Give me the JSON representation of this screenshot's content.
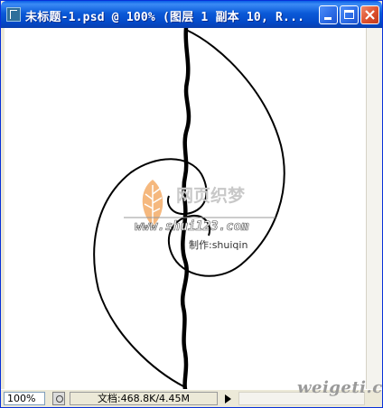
{
  "window": {
    "title": "未标题-1.psd @ 100% (图层 1 副本 10, R..."
  },
  "status": {
    "zoom": "100%",
    "doc_info": "文档:468.8K/4.45M"
  },
  "watermark": {
    "logo_text": "网页织梦",
    "url": "www.shui123.com",
    "credit": "制作:shuiqin",
    "corner": "weigeti.com"
  },
  "colors": {
    "titlebar": "#0b5ad8",
    "close_button": "#dc4f2c",
    "leaf_orange": "#f0a25a",
    "watermark_text": "#c8c8c8"
  }
}
